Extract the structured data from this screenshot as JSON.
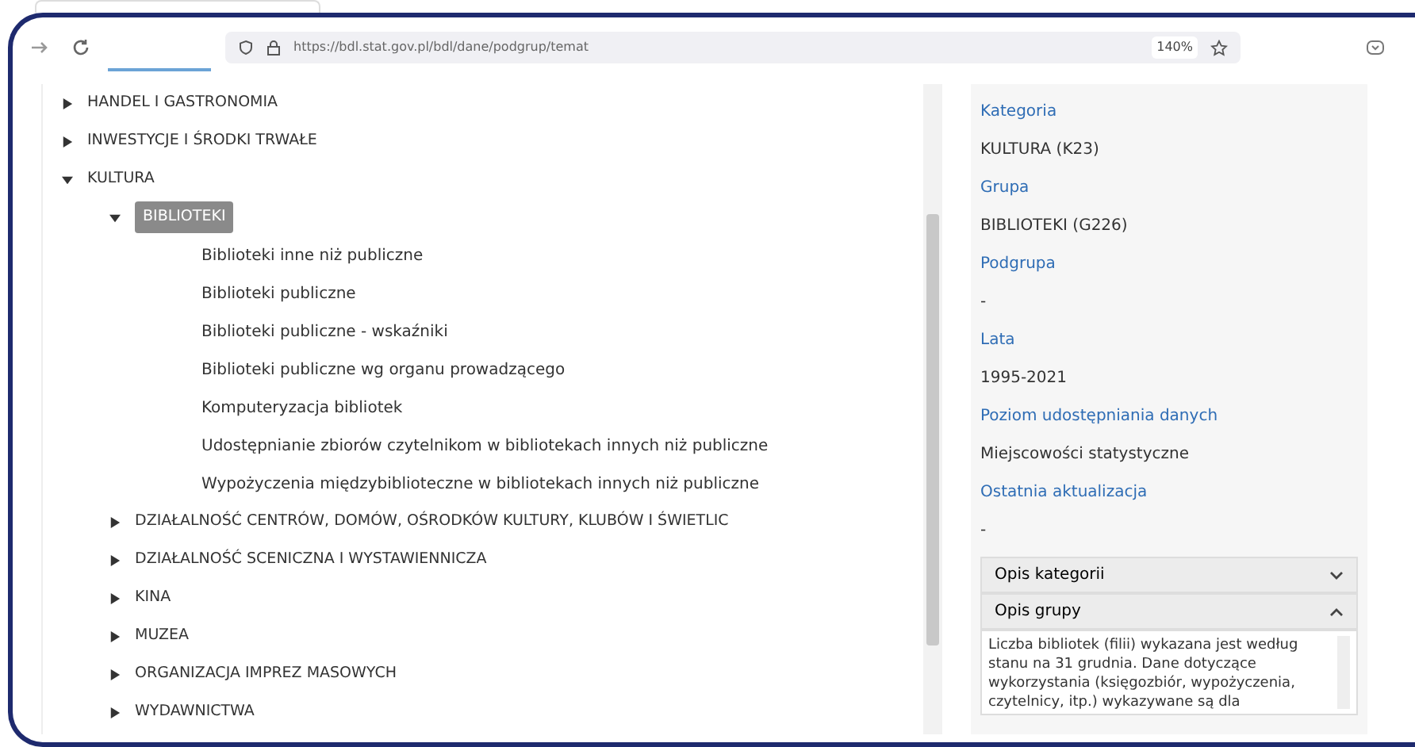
{
  "browser": {
    "url": "https://bdl.stat.gov.pl/bdl/dane/podgrup/temat",
    "zoom": "140%"
  },
  "tree": [
    {
      "label": "HANDEL I GASTRONOMIA",
      "expanded": false,
      "selected": false
    },
    {
      "label": "INWESTYCJE I ŚRODKI TRWAŁE",
      "expanded": false,
      "selected": false
    },
    {
      "label": "KULTURA",
      "expanded": true,
      "selected": false,
      "children": [
        {
          "label": "BIBLIOTEKI",
          "expanded": true,
          "selected": true,
          "children": [
            {
              "label": "Biblioteki inne niż publiczne",
              "selected": false
            },
            {
              "label": "Biblioteki publiczne",
              "selected": false
            },
            {
              "label": "Biblioteki publiczne - wskaźniki",
              "selected": false
            },
            {
              "label": "Biblioteki publiczne wg organu prowadzącego",
              "selected": false
            },
            {
              "label": "Komputeryzacja bibliotek",
              "selected": false
            },
            {
              "label": "Udostępnianie zbiorów czytelnikom w bibliotekach innych niż publiczne",
              "selected": false
            },
            {
              "label": "Wypożyczenia międzybiblioteczne w bibliotekach innych niż publiczne",
              "selected": false
            }
          ]
        },
        {
          "label": "DZIAŁALNOŚĆ CENTRÓW, DOMÓW, OŚRODKÓW KULTURY, KLUBÓW I ŚWIETLIC",
          "expanded": false,
          "selected": false
        },
        {
          "label": "DZIAŁALNOŚĆ SCENICZNA I WYSTAWIENNICZA",
          "expanded": false,
          "selected": false
        },
        {
          "label": "KINA",
          "expanded": false,
          "selected": false
        },
        {
          "label": "MUZEA",
          "expanded": false,
          "selected": false
        },
        {
          "label": "ORGANIZACJA IMPREZ MASOWYCH",
          "expanded": false,
          "selected": false
        },
        {
          "label": "WYDAWNICTWA",
          "expanded": false,
          "selected": false
        }
      ]
    }
  ],
  "details": [
    {
      "label": "Kategoria",
      "value": "KULTURA (K23)"
    },
    {
      "label": "Grupa",
      "value": "BIBLIOTEKI (G226)"
    },
    {
      "label": "Podgrupa",
      "value": "-"
    },
    {
      "label": "Lata",
      "value": "1995-2021"
    },
    {
      "label": "Poziom udostępniania danych",
      "value": "Miejscowości statystyczne"
    },
    {
      "label": "Ostatnia aktualizacja",
      "value": "-"
    }
  ],
  "accordion": [
    {
      "title": "Opis kategorii",
      "expanded": false
    },
    {
      "title": "Opis grupy",
      "expanded": true,
      "body": "Liczba bibliotek (filii) wykazana jest według stanu na 31 grudnia. Dane dotyczące wykorzystania (księgozbiór, wypożyczenia, czytelnicy, itp.) wykazywane są dla"
    }
  ]
}
